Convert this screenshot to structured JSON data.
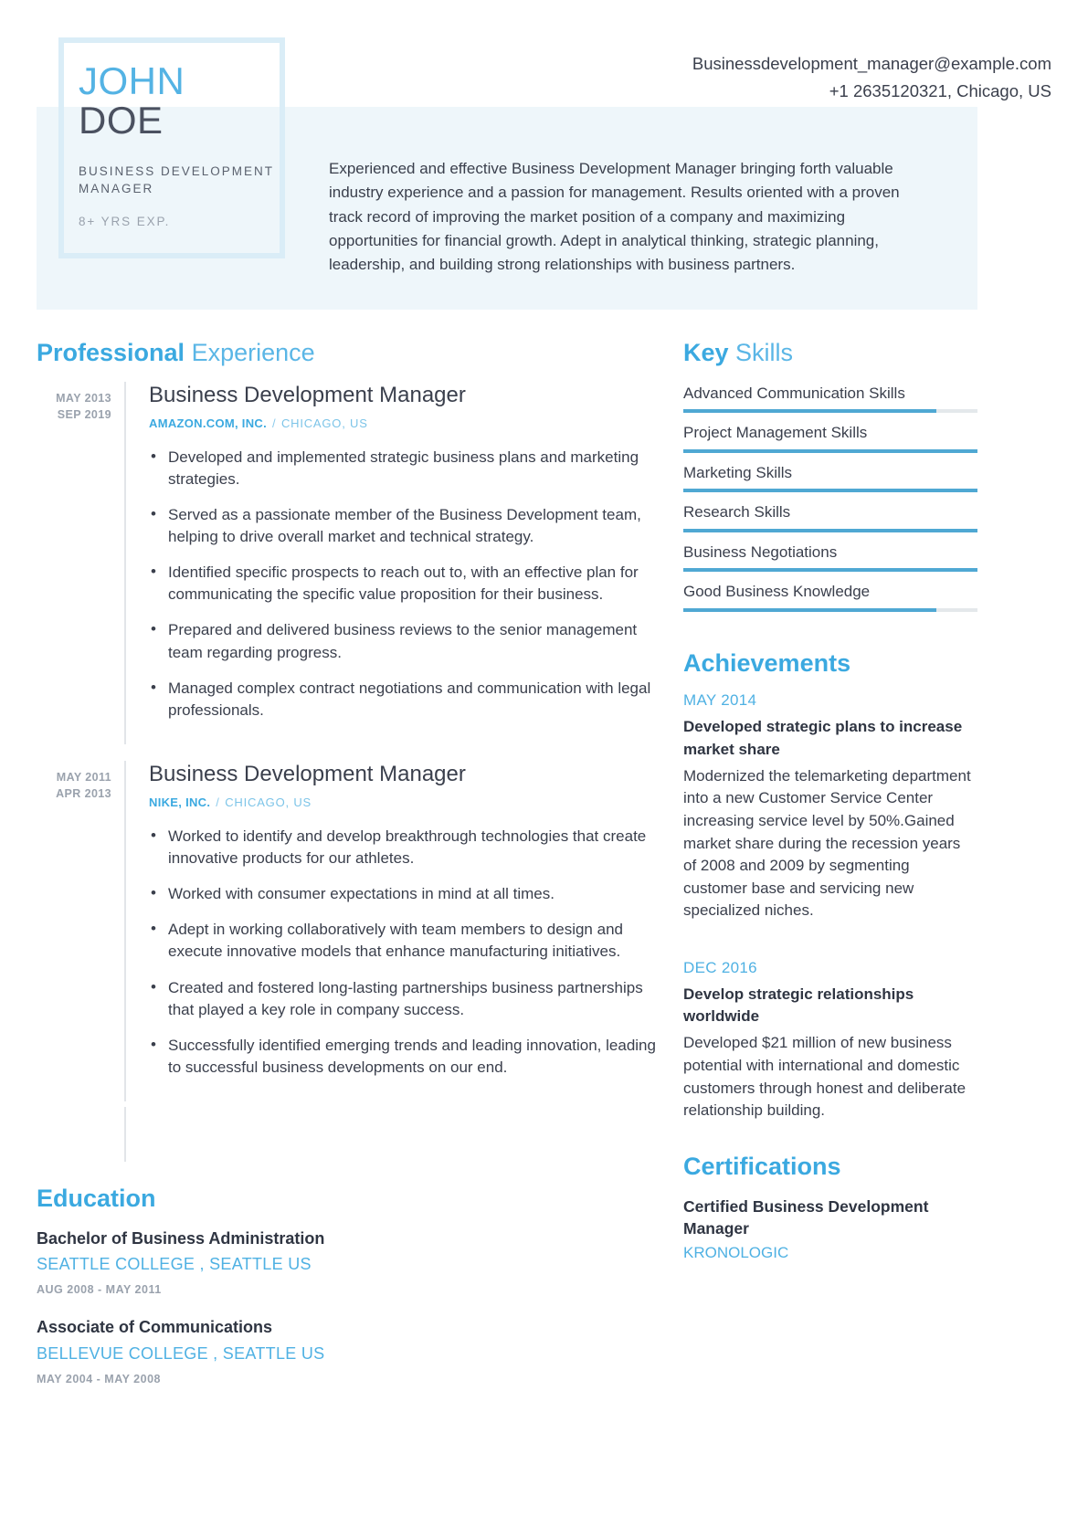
{
  "header": {
    "first_name": "JOHN",
    "last_name": "DOE",
    "job_role": "BUSINESS DEVELOPMENT MANAGER",
    "years_experience": "8+ YRS EXP.",
    "email": "Businessdevelopment_manager@example.com",
    "phone_location": "+1 2635120321, Chicago, US",
    "summary": "Experienced and effective Business Development Manager bringing forth valuable industry experience and a passion for management. Results oriented with a proven track record of improving the market position of a company and maximizing opportunities for financial growth. Adept in analytical thinking, strategic planning, leadership, and building strong relationships with business partners."
  },
  "experience": {
    "heading_bold": "Professional",
    "heading_normal": "Experience",
    "items": [
      {
        "date_start": "MAY 2013",
        "date_end": "SEP 2019",
        "title": "Business Development Manager",
        "company": "AMAZON.COM, INC.",
        "separator": "/",
        "location": "CHICAGO, US",
        "bullets": [
          " Developed and implemented strategic business plans and marketing strategies.",
          "Served as a passionate member of the Business Development team, helping to drive overall market and technical strategy.",
          "Identified specific prospects to reach out to, with an effective plan for communicating the specific value proposition for their business.",
          "Prepared and delivered business reviews to the senior management team regarding progress.",
          "Managed complex contract negotiations and communication with legal professionals."
        ]
      },
      {
        "date_start": "MAY 2011",
        "date_end": "APR 2013",
        "title": "Business Development Manager",
        "company": "NIKE, INC.",
        "separator": "/",
        "location": "CHICAGO, US",
        "bullets": [
          " Worked to identify and develop breakthrough technologies that create innovative products for our athletes.",
          "Worked with consumer expectations in mind at all times.",
          "Adept in working collaboratively with team members to design and execute innovative models that enhance manufacturing initiatives.",
          "Created and fostered long-lasting partnerships business partnerships that played a key role in company success.",
          "Successfully identified emerging trends and leading innovation, leading to successful business developments on our end."
        ]
      }
    ]
  },
  "education": {
    "heading_bold": "Education",
    "items": [
      {
        "degree": "Bachelor of Business Administration",
        "school": "SEATTLE COLLEGE , SEATTLE US",
        "dates": "AUG 2008 - MAY 2011"
      },
      {
        "degree": "Associate of Communications",
        "school": "BELLEVUE COLLEGE , SEATTLE US",
        "dates": "MAY 2004 - MAY 2008"
      }
    ]
  },
  "skills": {
    "heading_bold": "Key",
    "heading_normal": "Skills",
    "items": [
      {
        "label": "Advanced Communication Skills",
        "level": 86
      },
      {
        "label": "Project Management Skills",
        "level": 100
      },
      {
        "label": "Marketing Skills",
        "level": 100
      },
      {
        "label": "Research Skills",
        "level": 100
      },
      {
        "label": "Business Negotiations",
        "level": 100
      },
      {
        "label": "Good Business Knowledge",
        "level": 86
      }
    ]
  },
  "achievements": {
    "heading_bold": "Achievements",
    "items": [
      {
        "date": "MAY 2014",
        "title": "Developed strategic plans to increase market share",
        "description": "Modernized the telemarketing department into a new Customer Service Center increasing service level by 50%.Gained market share during the recession years of 2008 and 2009 by segmenting customer base and servicing new specialized niches."
      },
      {
        "date": "DEC 2016",
        "title": "Develop strategic relationships worldwide",
        "description": " Developed $21 million of new business potential with international and domestic customers through honest and deliberate relationship building."
      }
    ]
  },
  "certifications": {
    "heading_bold": "Certifications",
    "items": [
      {
        "title": "Certified Business Development Manager",
        "organization": "KRONOLOGIC"
      }
    ]
  },
  "colors": {
    "accent_blue": "#3ba9e0",
    "light_blue": "#54b3e4",
    "band_bg": "#eef6fa",
    "text_dark": "#3a3f4c",
    "muted_gray": "#9aa2ad"
  }
}
